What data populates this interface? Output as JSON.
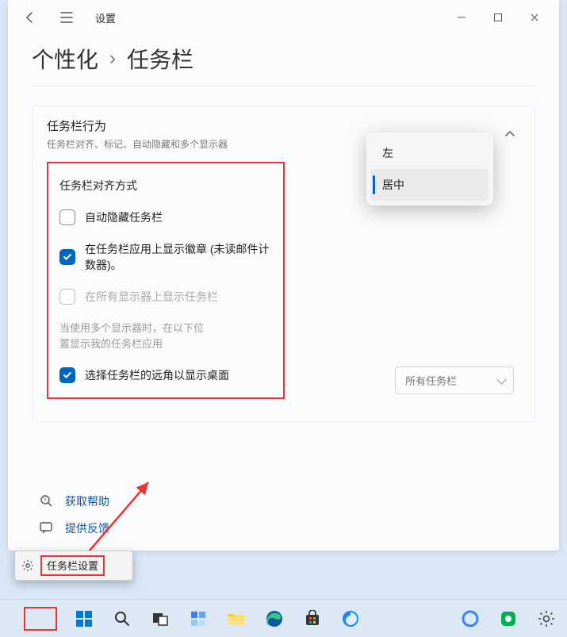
{
  "app": {
    "name": "设置"
  },
  "breadcrumb": {
    "parent": "个性化",
    "current": "任务栏"
  },
  "section": {
    "title": "任务栏行为",
    "subtitle": "任务栏对齐、标记、自动隐藏和多个显示器"
  },
  "behaviors": {
    "alignment_label": "任务栏对齐方式",
    "auto_hide": {
      "label": "自动隐藏任务栏",
      "checked": false
    },
    "badges": {
      "label": "在任务栏应用上显示徽章 (未读邮件计数器)。",
      "checked": true
    },
    "all_displays": {
      "label": "在所有显示器上显示任务栏",
      "checked": false,
      "disabled": true
    },
    "multi_monitor": {
      "label": "当使用多个显示器时，在以下位置显示我的任务栏应用",
      "dropdown_value": "所有任务栏"
    },
    "far_corner": {
      "label": "选择任务栏的远角以显示桌面",
      "checked": true
    }
  },
  "alignment_popup": {
    "options": [
      {
        "label": "左",
        "selected": false
      },
      {
        "label": "居中",
        "selected": true
      }
    ]
  },
  "footer": {
    "help": "获取帮助",
    "feedback": "提供反馈"
  },
  "context_menu": {
    "label": "任务栏设置"
  },
  "taskbar_icons": [
    "start",
    "search",
    "taskview",
    "widgets",
    "explorer",
    "edge",
    "store",
    "browser2",
    "cortana",
    "app-green",
    "settings"
  ]
}
